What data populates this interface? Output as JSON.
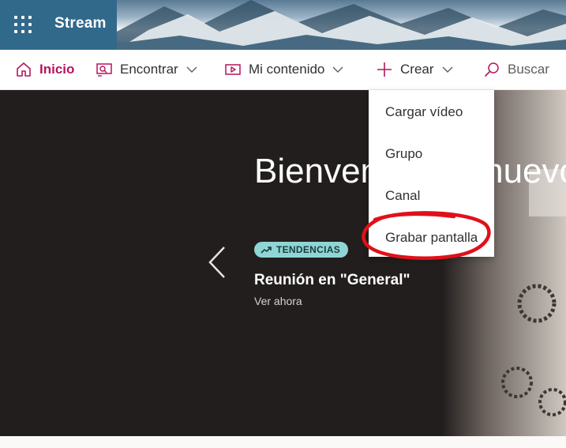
{
  "app": {
    "name": "Stream",
    "brand_color": "#31698a",
    "accent_color": "#b4155e"
  },
  "nav": {
    "items": [
      {
        "label": "Inicio",
        "icon": "home-icon",
        "active": true
      },
      {
        "label": "Encontrar",
        "icon": "find-icon",
        "has_dropdown": true
      },
      {
        "label": "Mi contenido",
        "icon": "video-icon",
        "has_dropdown": true
      },
      {
        "label": "Crear",
        "icon": "plus-icon",
        "has_dropdown": true,
        "expanded": true
      },
      {
        "label": "Buscar",
        "icon": "search-icon"
      }
    ]
  },
  "create_menu": {
    "items": [
      {
        "label": "Cargar vídeo"
      },
      {
        "label": "Grupo"
      },
      {
        "label": "Canal"
      },
      {
        "label": "Grabar pantalla",
        "highlighted": true
      }
    ],
    "highlight_color": "#e0101a"
  },
  "hero": {
    "title": "Bienvenido de nuevo,",
    "badge": "TENDENCIAS",
    "badge_icon": "trending-icon",
    "badge_color": "#8fd5d5",
    "video_title": "Reunión en \"General\"",
    "watch_label": "Ver ahora"
  }
}
